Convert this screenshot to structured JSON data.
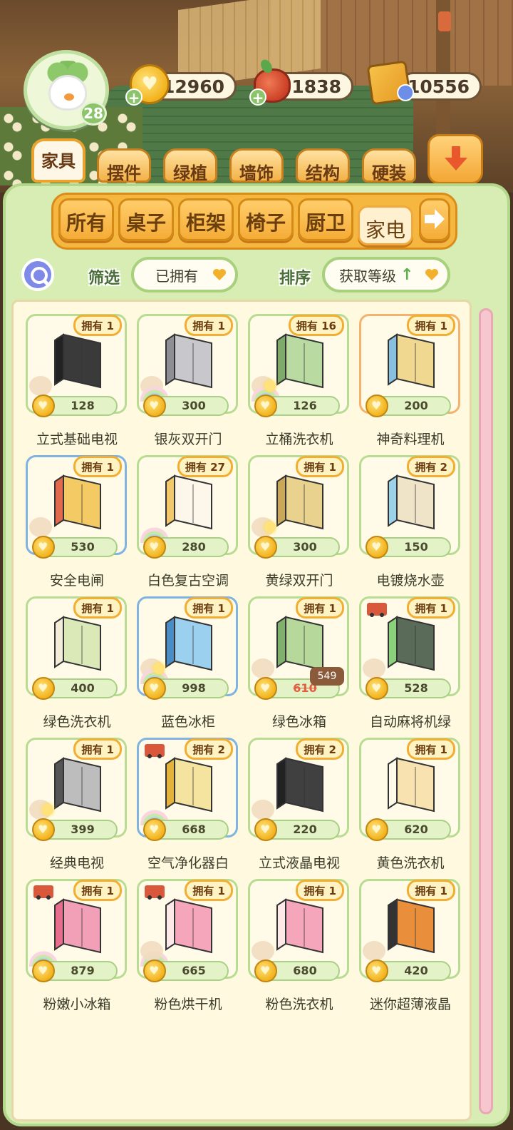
{
  "player": {
    "level": "28"
  },
  "currencies": {
    "coins": "12960",
    "tomatoes": "1838",
    "books": "10556"
  },
  "category_tabs": [
    "家具",
    "摆件",
    "绿植",
    "墙饰",
    "结构",
    "硬装"
  ],
  "active_category": "家具",
  "sub_tabs": [
    "所有",
    "桌子",
    "柜架",
    "椅子",
    "厨卫",
    "家电"
  ],
  "active_sub_tab": "家电",
  "filter": {
    "label": "筛选",
    "value": "已拥有"
  },
  "sort": {
    "label": "排序",
    "value": "获取等级",
    "direction_icon": "up-arrow-icon"
  },
  "items": [
    {
      "name": "立式基础电视",
      "owned": "拥有 1",
      "price": "128"
    },
    {
      "name": "银灰双开门",
      "owned": "拥有 1",
      "price": "300"
    },
    {
      "name": "立桶洗衣机",
      "owned": "拥有 16",
      "price": "126"
    },
    {
      "name": "神奇料理机",
      "owned": "拥有 1",
      "price": "200"
    },
    {
      "name": "安全电闸",
      "owned": "拥有 1",
      "price": "530"
    },
    {
      "name": "白色复古空调",
      "owned": "拥有 27",
      "price": "280"
    },
    {
      "name": "黄绿双开门",
      "owned": "拥有 1",
      "price": "300"
    },
    {
      "name": "电镀烧水壶",
      "owned": "拥有 2",
      "price": "150"
    },
    {
      "name": "绿色洗衣机",
      "owned": "拥有 1",
      "price": "400"
    },
    {
      "name": "蓝色冰柜",
      "owned": "拥有 1",
      "price": "998"
    },
    {
      "name": "绿色冰箱",
      "owned": "拥有 1",
      "price": "610",
      "sale_price": "549"
    },
    {
      "name": "自动麻将机绿",
      "owned": "拥有 1",
      "price": "528"
    },
    {
      "name": "经典电视",
      "owned": "拥有 1",
      "price": "399"
    },
    {
      "name": "空气净化器白",
      "owned": "拥有 2",
      "price": "668"
    },
    {
      "name": "立式液晶电视",
      "owned": "拥有 2",
      "price": "220"
    },
    {
      "name": "黄色洗衣机",
      "owned": "拥有 1",
      "price": "620"
    },
    {
      "name": "粉嫩小冰箱",
      "owned": "拥有 1",
      "price": "879"
    },
    {
      "name": "粉色烘干机",
      "owned": "拥有 1",
      "price": "665"
    },
    {
      "name": "粉色洗衣机",
      "owned": "拥有 1",
      "price": "680"
    },
    {
      "name": "迷你超薄液晶",
      "owned": "拥有 1",
      "price": "420"
    }
  ],
  "colors": {
    "panel_green": "#d7edb4",
    "tab_orange": "#f3b247",
    "badge_border": "#f1ae32",
    "list_bg": "#fff9df"
  }
}
